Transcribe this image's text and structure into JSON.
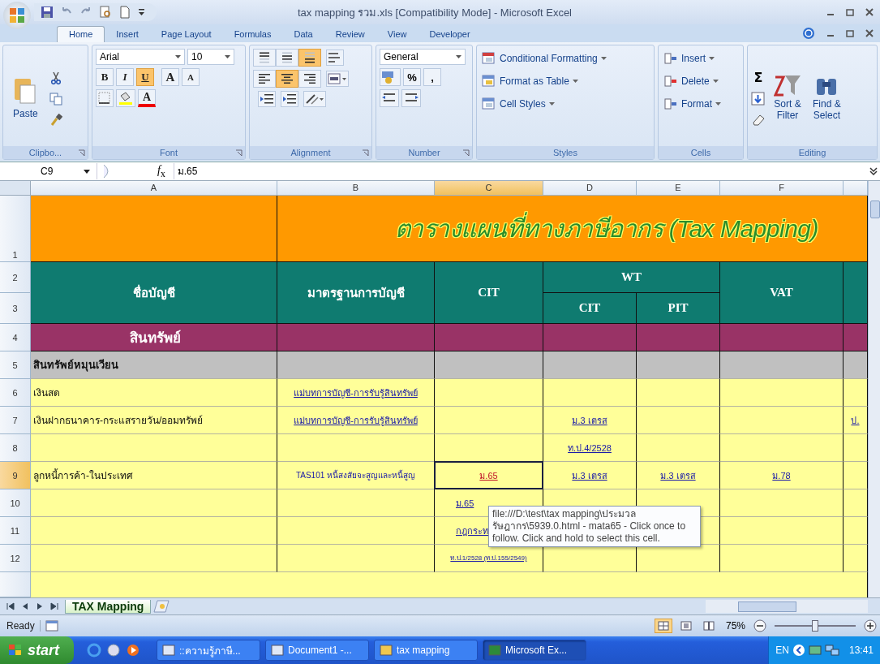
{
  "window": {
    "title": "tax mapping รวม.xls  [Compatibility Mode] - Microsoft Excel"
  },
  "ribbon_tabs": [
    {
      "label": "Home",
      "selected": true
    },
    {
      "label": "Insert",
      "selected": false
    },
    {
      "label": "Page Layout",
      "selected": false
    },
    {
      "label": "Formulas",
      "selected": false
    },
    {
      "label": "Data",
      "selected": false
    },
    {
      "label": "Review",
      "selected": false
    },
    {
      "label": "View",
      "selected": false
    },
    {
      "label": "Developer",
      "selected": false
    }
  ],
  "ribbon": {
    "clipboard": {
      "label": "Clipbo...",
      "paste": "Paste"
    },
    "font": {
      "label": "Font",
      "family": "Arial",
      "size": "10",
      "style_buttons": [
        {
          "text": "B",
          "selected": false
        },
        {
          "text": "I",
          "selected": false
        },
        {
          "text": "U",
          "selected": true
        }
      ],
      "grow": "A",
      "shrink": "A",
      "color_letter": "A"
    },
    "alignment": {
      "label": "Alignment",
      "vertical": [
        {
          "selected": false
        },
        {
          "selected": false
        },
        {
          "selected": true
        }
      ],
      "horizontal": [
        {
          "selected": false
        },
        {
          "selected": true
        },
        {
          "selected": false
        }
      ]
    },
    "number": {
      "label": "Number",
      "format": "General",
      "percent": "%",
      "comma": ","
    },
    "styles": {
      "label": "Styles",
      "items": [
        "Conditional Formatting",
        "Format as Table",
        "Cell Styles"
      ]
    },
    "cells": {
      "label": "Cells",
      "items": [
        "Insert",
        "Delete",
        "Format"
      ]
    },
    "editing": {
      "label": "Editing",
      "sigma": "Σ",
      "sort": [
        "Sort &",
        "Filter"
      ],
      "find": [
        "Find &",
        "Select"
      ]
    }
  },
  "formula_bar": {
    "name_box": "C9",
    "fx": "*f*$_{x}$",
    "value": "ม.65"
  },
  "sheet": {
    "columns": [
      {
        "label": "A",
        "selected": false
      },
      {
        "label": "B",
        "selected": false
      },
      {
        "label": "C",
        "selected": true
      },
      {
        "label": "D",
        "selected": false
      },
      {
        "label": "E",
        "selected": false
      },
      {
        "label": "F",
        "selected": false
      }
    ],
    "title_row": {
      "number": "1",
      "title": "ตารางแผนที่ทางภาษีอากร (Tax Mapping)"
    },
    "header_rows": {
      "numbers": [
        "2",
        "3"
      ],
      "account": "ชื่อบัญชี",
      "standard": "มาตรฐานการบัญชี",
      "cit": "CIT",
      "wt": "WT",
      "wt_cit": "CIT",
      "wt_pit": "PIT",
      "vat": "VAT"
    },
    "rows": [
      {
        "number": "4",
        "kind": "category",
        "selected": false,
        "cells": [
          {
            "text": "สินทรัพย์",
            "kind": "heading"
          },
          null,
          null,
          null,
          null,
          null,
          null
        ]
      },
      {
        "number": "5",
        "kind": "group",
        "selected": false,
        "cells": [
          {
            "text": "สินทรัพย์หมุนเวียน",
            "kind": "bold"
          },
          null,
          null,
          null,
          null,
          null,
          null
        ]
      },
      {
        "number": "6",
        "kind": "item",
        "selected": false,
        "cells": [
          {
            "text": "เงินสด",
            "kind": "text"
          },
          {
            "text": "แม่บทการบัญชี-การรับรู้สินทรัพย์",
            "kind": "link"
          },
          null,
          null,
          null,
          null,
          null
        ]
      },
      {
        "number": "7",
        "kind": "item",
        "selected": false,
        "cells": [
          {
            "text": "เงินฝากธนาคาร-กระแสรายวัน/ออมทรัพย์",
            "kind": "text"
          },
          {
            "text": "แม่บทการบัญชี-การรับรู้สินทรัพย์",
            "kind": "link"
          },
          null,
          {
            "text": "ม.3 เตรส",
            "kind": "link"
          },
          null,
          null,
          {
            "text": "ป.",
            "kind": "link"
          }
        ]
      },
      {
        "number": "8",
        "kind": "item",
        "selected": false,
        "cells": [
          null,
          null,
          null,
          {
            "text": "ท.ป.4/2528",
            "kind": "link"
          },
          null,
          null,
          null
        ]
      },
      {
        "number": "9",
        "kind": "item",
        "selected": true,
        "cells": [
          {
            "text": "ลูกหนี้การค้า-ในประเทศ",
            "kind": "text"
          },
          {
            "text": "TAS101 หนี้สงสัยจะสูญและหนี้สูญ",
            "kind": "blue_text"
          },
          {
            "text": "ม.65",
            "kind": "followed_link"
          },
          {
            "text": "ม.3 เตรส",
            "kind": "link"
          },
          {
            "text": "ม.3 เตรส",
            "kind": "link"
          },
          {
            "text": "ม.78",
            "kind": "link"
          },
          null
        ]
      },
      {
        "number": "10",
        "kind": "item",
        "selected": false,
        "cells": [
          null,
          null,
          {
            "text": "ม.65",
            "kind": "partial_link"
          },
          null,
          null,
          null,
          null
        ]
      },
      {
        "number": "11",
        "kind": "item",
        "selected": false,
        "cells": [
          null,
          null,
          {
            "text": "กฎกระท",
            "kind": "partial_link"
          },
          null,
          null,
          null,
          null
        ]
      },
      {
        "number": "12",
        "kind": "item",
        "selected": false,
        "cells": [
          null,
          null,
          {
            "text": "ท.ป.1/2528 (ท.ป.155/2549)",
            "kind": "small_link"
          },
          null,
          null,
          null,
          null
        ]
      }
    ]
  },
  "tooltip": {
    "text": "file:///D:\\test\\tax mapping\\ประมวลรัษฎากร\\5939.0.html - mata65 - Click once to follow. Click and hold to select this cell."
  },
  "sheet_tabs": [
    {
      "label": "TAX Mapping",
      "selected": true
    }
  ],
  "status_bar": {
    "text": "Ready",
    "views": [
      {
        "selected": true
      },
      {
        "selected": false
      },
      {
        "selected": false
      }
    ],
    "zoom": "75%",
    "zoom_slider": {
      "level": 0.5
    }
  },
  "taskbar": {
    "start": "start",
    "tasks": [
      {
        "label": "::ความรู้ภาษี...",
        "selected": false
      },
      {
        "label": "Document1 -...",
        "selected": false
      },
      {
        "label": "tax mapping",
        "selected": false
      },
      {
        "label": "Microsoft Ex...",
        "selected": true
      }
    ],
    "language": "EN",
    "clock": "13:41"
  }
}
